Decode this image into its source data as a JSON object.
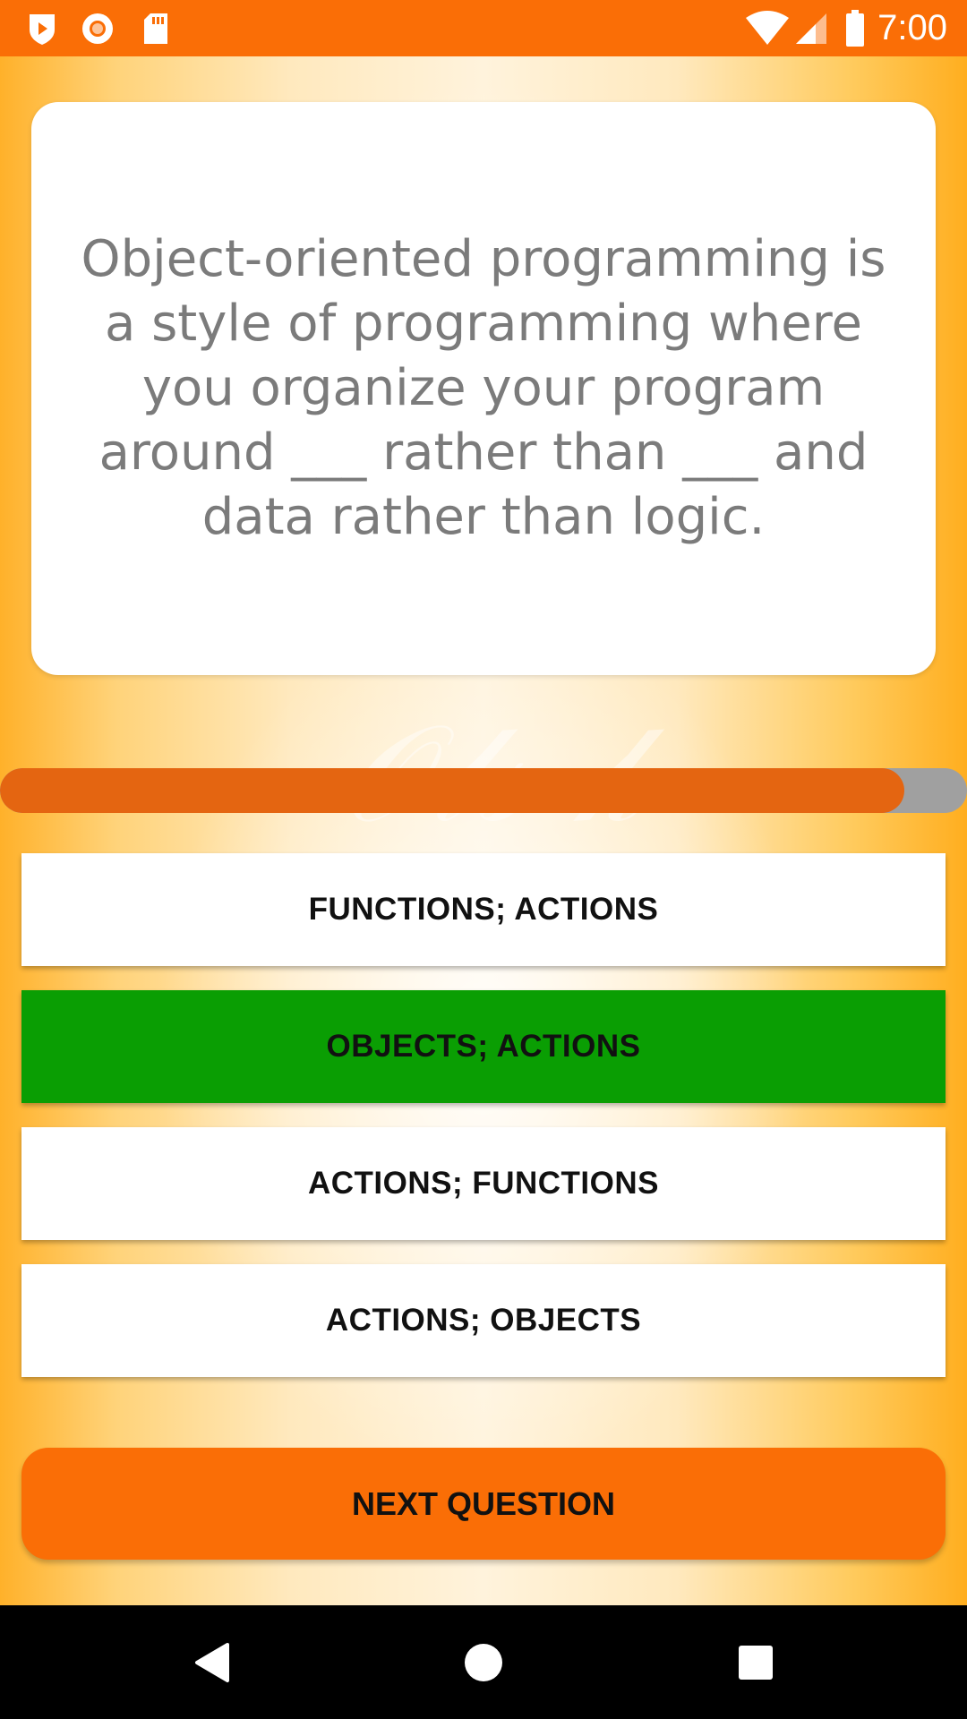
{
  "status_bar": {
    "time": "7:00",
    "left_icons": [
      "play-shield-icon",
      "record-icon",
      "sd-card-icon"
    ],
    "right_icons": [
      "wifi-icon",
      "signal-icon",
      "battery-icon"
    ]
  },
  "question": {
    "text": "Object-oriented programming is a style of programming where you organize your program around ___ rather than ___ and data rather than logic."
  },
  "progress": {
    "value": 0.935
  },
  "answers": [
    {
      "label": "FUNCTIONS; ACTIONS",
      "state": "default"
    },
    {
      "label": "OBJECTS; ACTIONS",
      "state": "correct"
    },
    {
      "label": "ACTIONS; FUNCTIONS",
      "state": "default"
    },
    {
      "label": "ACTIONS; OBJECTS",
      "state": "default"
    }
  ],
  "next_button": {
    "label": "NEXT QUESTION"
  },
  "nav_bar": {
    "buttons": [
      "back-icon",
      "home-icon",
      "recents-icon"
    ]
  },
  "colors": {
    "accent": "#FA6E06",
    "progress_fill": "#E46511",
    "progress_track": "#A0A0A0",
    "correct": "#0A9E03",
    "question_text": "#7B7B7B"
  }
}
